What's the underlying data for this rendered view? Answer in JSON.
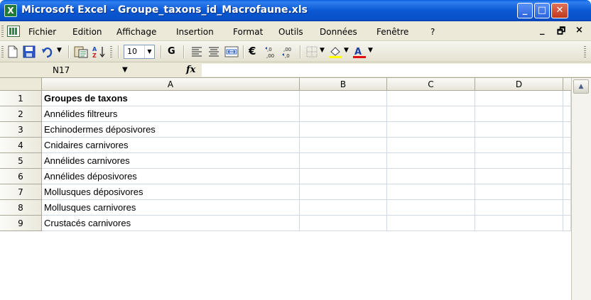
{
  "window": {
    "title": "Microsoft Excel - Groupe_taxons_id_Macrofaune.xls",
    "app_icon_glyph": "X"
  },
  "menu": {
    "items": [
      "Fichier",
      "Edition",
      "Affichage",
      "Insertion",
      "Format",
      "Outils",
      "Données",
      "Fenêtre",
      "?"
    ],
    "right_controls": [
      "_",
      "🗗",
      "×"
    ]
  },
  "toolbar": {
    "font_size": "10",
    "bold_label": "G",
    "euro_label": "€",
    "icons": [
      "new-icon",
      "save-icon",
      "undo-icon",
      "paste-special-icon",
      "sort-icon",
      "align-left-icon",
      "center-icon",
      "merge-icon",
      "euro-icon",
      "increase-decimal-icon",
      "decrease-decimal-icon",
      "borders-icon",
      "fill-color-icon",
      "font-color-icon"
    ]
  },
  "formula_bar": {
    "name_box": "N17",
    "fx_label": "fx",
    "formula": ""
  },
  "grid": {
    "columns": [
      "A",
      "B",
      "C",
      "D"
    ],
    "rows": [
      {
        "num": "1",
        "A": "Groupes de taxons",
        "bold": true
      },
      {
        "num": "2",
        "A": "Annélides filtreurs"
      },
      {
        "num": "3",
        "A": "Echinodermes déposivores"
      },
      {
        "num": "4",
        "A": "Cnidaires carnivores"
      },
      {
        "num": "5",
        "A": "Annélides carnivores"
      },
      {
        "num": "6",
        "A": "Annélides déposivores"
      },
      {
        "num": "7",
        "A": "Mollusques déposivores"
      },
      {
        "num": "8",
        "A": "Mollusques carnivores"
      },
      {
        "num": "9",
        "A": "Crustacés carnivores"
      }
    ]
  }
}
